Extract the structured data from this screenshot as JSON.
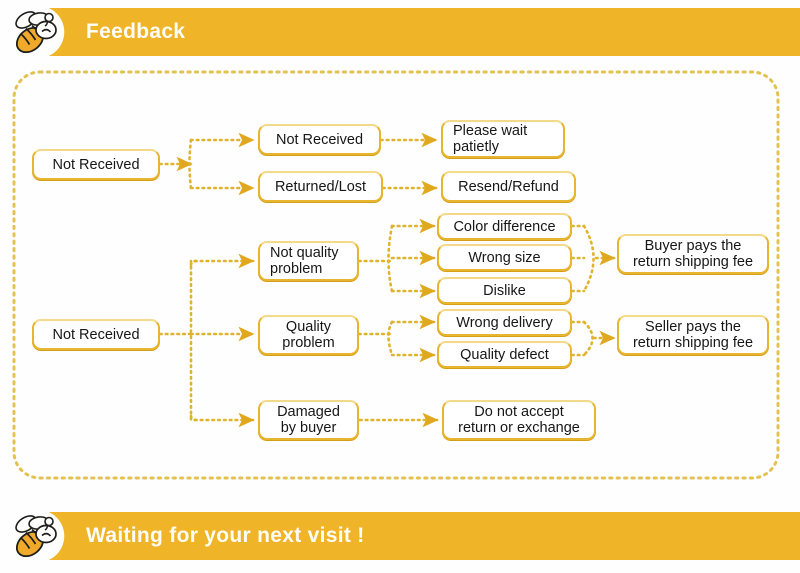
{
  "header": {
    "title": "Feedback",
    "icon": "bee-icon",
    "accent_color": "#f0b429",
    "title_color": "#fdfdf8"
  },
  "footer": {
    "title": "Waiting for your next visit !",
    "icon": "bee-icon",
    "accent_color": "#f0b429",
    "title_color": "#fdfdf8"
  },
  "panel": {
    "border_color": "#e3c251",
    "border_style": "dotted",
    "background": "#ffffff"
  },
  "flowchart": {
    "type": "diagram",
    "node_border_color": "#e8b530",
    "node_fill": "#ffffff",
    "connector_color": "#e0b32c",
    "branches": [
      {
        "id": "branch-not-received-top",
        "root": "Not Received",
        "level2": [
          {
            "label": "Not Received",
            "outcome": "Please wait\npatietly"
          },
          {
            "label": "Returned/Lost",
            "outcome": "Resend/Refund"
          }
        ]
      },
      {
        "id": "branch-not-received-bottom",
        "root": "Not Received",
        "level2": [
          {
            "label": "Not quality\nproblem",
            "reasons": [
              "Color difference",
              "Wrong size",
              "Dislike"
            ],
            "outcome": "Buyer pays the\nreturn shipping fee"
          },
          {
            "label": "Quality\nproblem",
            "reasons": [
              "Wrong delivery",
              "Quality defect"
            ],
            "outcome": "Seller pays the\nreturn shipping fee"
          },
          {
            "label": "Damaged\nby buyer",
            "reasons": [],
            "outcome": "Do not accept\nreturn or exchange"
          }
        ]
      }
    ],
    "nodes": {
      "root_top": "Not Received",
      "root_bottom": "Not Received",
      "n_not_received": "Not Received",
      "n_returned_lost": "Returned/Lost",
      "n_please_wait": "Please wait\npatietly",
      "n_resend_refund": "Resend/Refund",
      "n_not_quality": "Not quality\nproblem",
      "n_quality": "Quality\nproblem",
      "n_damaged": "Damaged\nby buyer",
      "n_color_difference": "Color difference",
      "n_wrong_size": "Wrong size",
      "n_dislike": "Dislike",
      "n_wrong_delivery": "Wrong delivery",
      "n_quality_defect": "Quality defect",
      "n_buyer_pays": "Buyer pays the\nreturn shipping fee",
      "n_seller_pays": "Seller pays the\nreturn shipping fee",
      "n_no_return": "Do not accept\nreturn or exchange"
    }
  }
}
